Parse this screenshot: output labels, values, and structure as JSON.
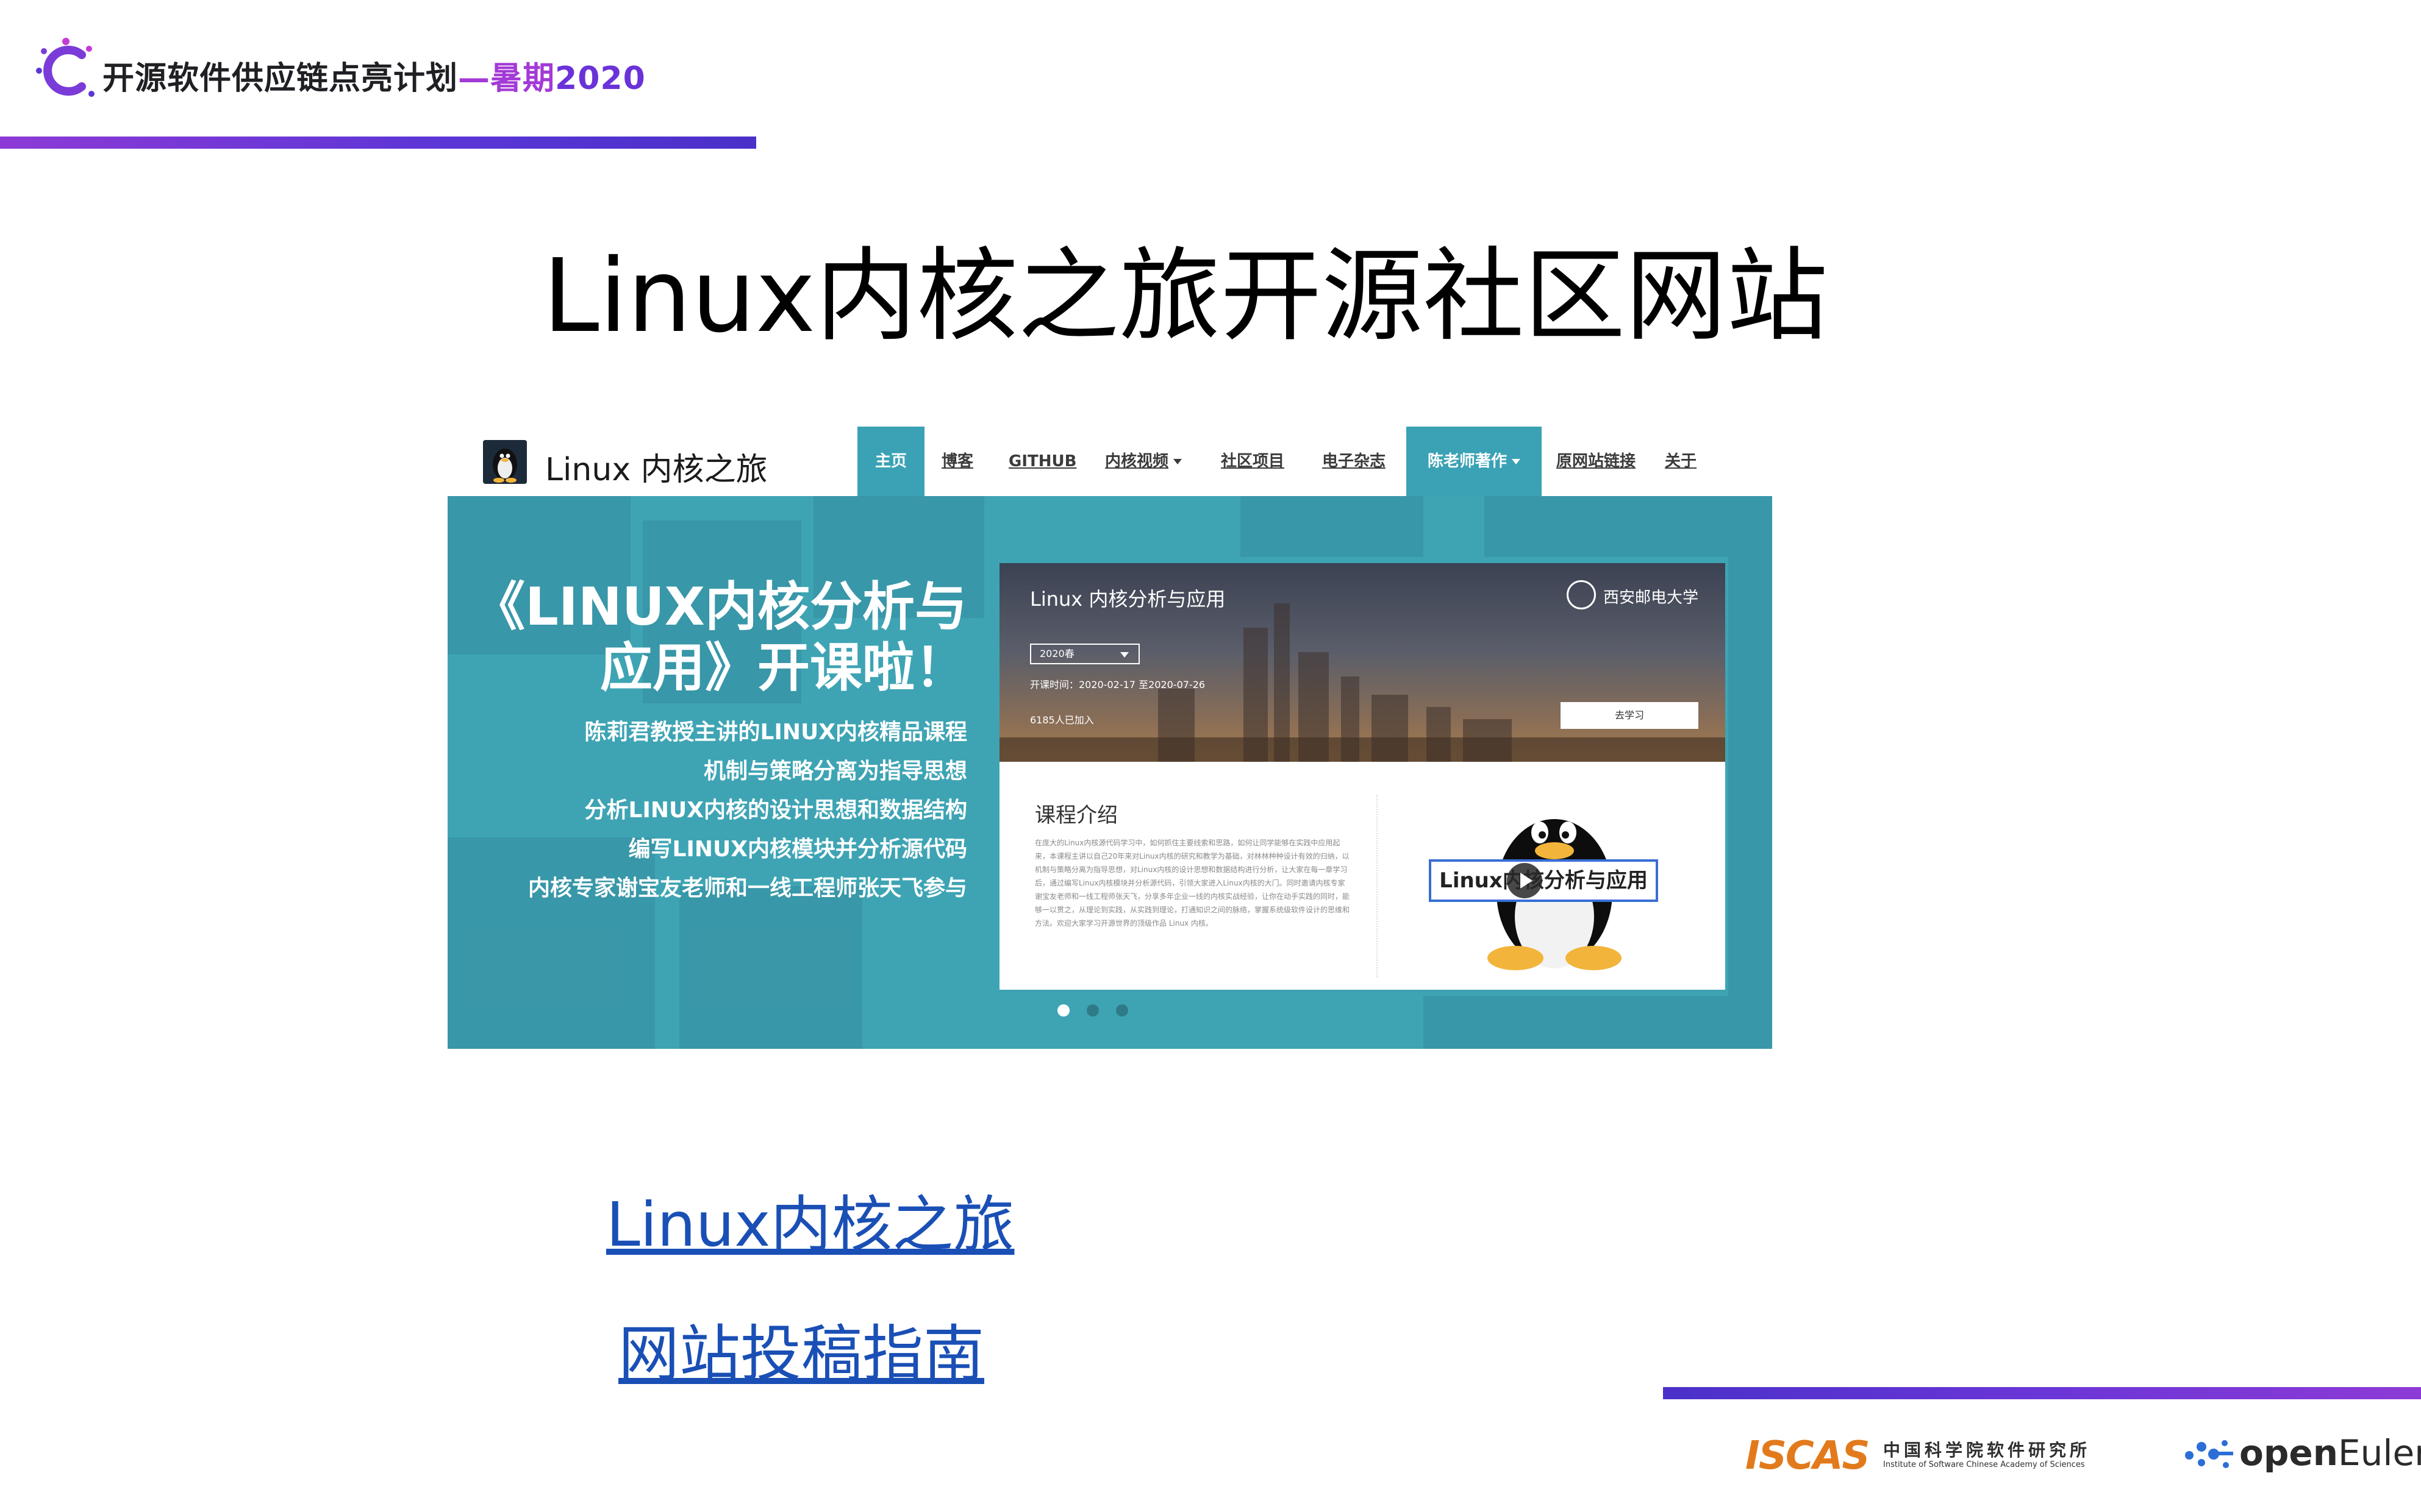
{
  "header": {
    "program_prefix": "开源软件供应链点亮计划",
    "program_dash": "—",
    "program_season": "暑期",
    "program_year": "2020"
  },
  "slide": {
    "title": "Linux内核之旅开源社区网站"
  },
  "website": {
    "site_name": "Linux 内核之旅",
    "nav": [
      {
        "label": "主页",
        "active": true
      },
      {
        "label": "博客"
      },
      {
        "label": "GITHUB"
      },
      {
        "label": "内核视频",
        "dropdown": true
      },
      {
        "label": "社区项目"
      },
      {
        "label": "电子杂志"
      },
      {
        "label": "陈老师著作",
        "dropdown": true,
        "active": true
      },
      {
        "label": "原网站链接"
      },
      {
        "label": "关于"
      }
    ],
    "hero": {
      "title_line1": "《LINUX内核分析与",
      "title_line2": "应用》开课啦！",
      "points": [
        "陈莉君教授主讲的LINUX内核精品课程",
        "机制与策略分离为指导思想",
        "分析LINUX内核的设计思想和数据结构",
        "编写LINUX内核模块并分析源代码",
        "内核专家谢宝友老师和一线工程师张天飞参与"
      ]
    },
    "course": {
      "name": "Linux 内核分析与应用",
      "university": "西安邮电大学",
      "term": "2020春",
      "dates": "开课时间：2020-02-17 至2020-07-26",
      "enrolled": "6185人已加入",
      "study_button": "去学习",
      "intro_title": "课程介绍",
      "intro_text": "在庞大的Linux内核源代码学习中，如何抓住主要线索和思路，如何让同学能够在实践中应用起来，本课程主讲以自己20年来对Linux内核的研究和教学为基础，对林林种种设计有效的归纳，以机制与策略分离为指导思想，对Linux内核的设计思想和数据结构进行分析，让大家在每一章学习后，通过编写Linux内核模块并分析源代码，引领大家进入Linux内核的大门。同时邀请内核专家谢宝友老师和一线工程师张天飞，分享多年企业一线的内核实战经验，让你在动手实践的同时，能够一以贯之，从理论到实践，从实践到理论，打通知识之间的脉络，掌握系统级软件设计的思维和方法。欢迎大家学习开源世界的顶级作品 Linux 内核。",
      "video_label": "Linux内核分析与应用"
    },
    "carousel": {
      "count": 3,
      "active": 0
    }
  },
  "links": [
    {
      "text": "Linux内核之旅"
    },
    {
      "text": "网站投稿指南"
    }
  ],
  "footer": {
    "iscas_logo": "ISCAS",
    "iscas_cn": "中国科学院软件研究所",
    "iscas_en": "Institute of Software Chinese Academy of Sciences",
    "openeuler_open": "open",
    "openeuler_euler": "Euler"
  },
  "colors": {
    "accent_purple": "#8d3ad6",
    "accent_blue": "#4b30c9",
    "site_teal": "#3ea4b4",
    "link_blue": "#1a4fb5",
    "iscas_orange": "#e27a1c"
  }
}
